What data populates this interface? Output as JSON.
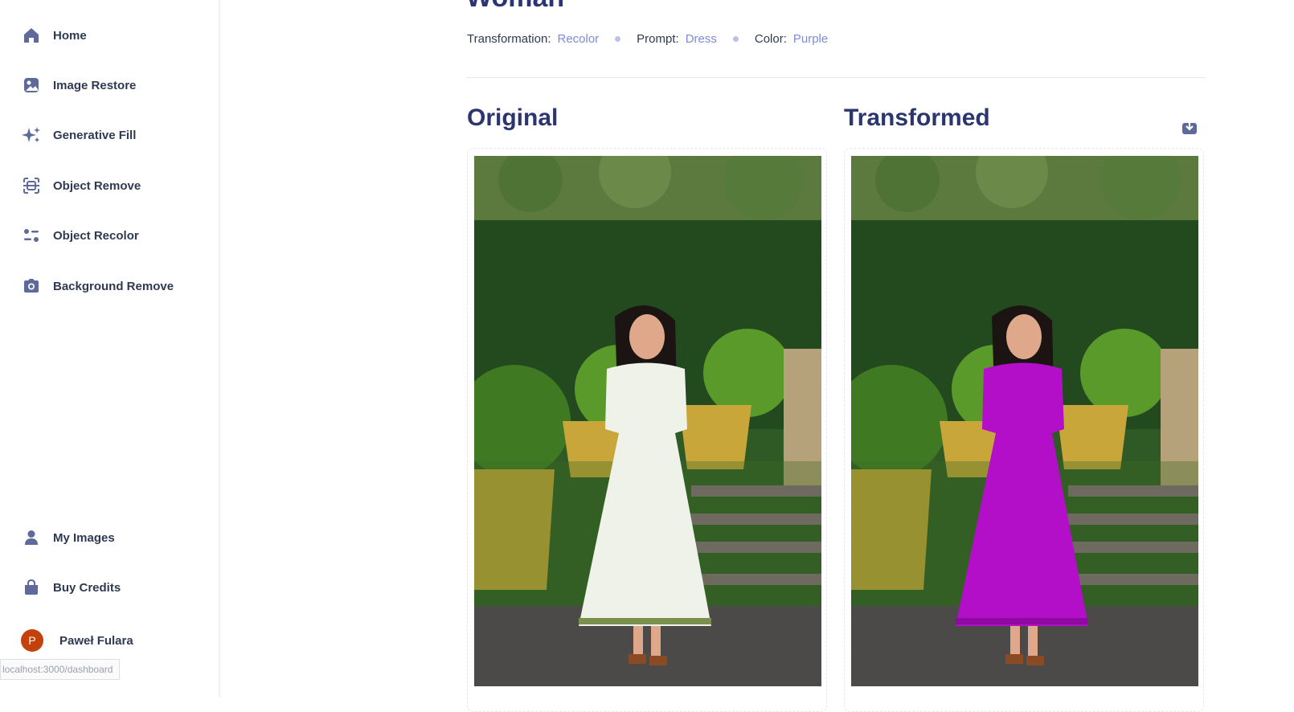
{
  "sidebar": {
    "items": [
      {
        "label": "Home",
        "icon": "home-icon"
      },
      {
        "label": "Image Restore",
        "icon": "image-icon"
      },
      {
        "label": "Generative Fill",
        "icon": "sparkles-icon"
      },
      {
        "label": "Object Remove",
        "icon": "scan-icon"
      },
      {
        "label": "Object Recolor",
        "icon": "filter-icon"
      },
      {
        "label": "Background Remove",
        "icon": "camera-icon"
      }
    ],
    "bottom_items": [
      {
        "label": "My Images",
        "icon": "profile-icon"
      },
      {
        "label": "Buy Credits",
        "icon": "bag-icon"
      }
    ],
    "user": {
      "name": "Paweł Fulara",
      "avatar_letter": "P"
    }
  },
  "status_bar": {
    "url": "localhost:3000/dashboard"
  },
  "main": {
    "title": "Woman",
    "meta": {
      "transformation_label": "Transformation:",
      "transformation_value": "Recolor",
      "prompt_label": "Prompt:",
      "prompt_value": "Dress",
      "color_label": "Color:",
      "color_value": "Purple"
    },
    "original_title": "Original",
    "transformed_title": "Transformed"
  },
  "colors": {
    "accent": "#7c8bdb",
    "heading": "#2b3570",
    "icon": "#5d6a9a",
    "dress_original": "#eef2e8",
    "dress_transformed": "#b40fc8"
  }
}
